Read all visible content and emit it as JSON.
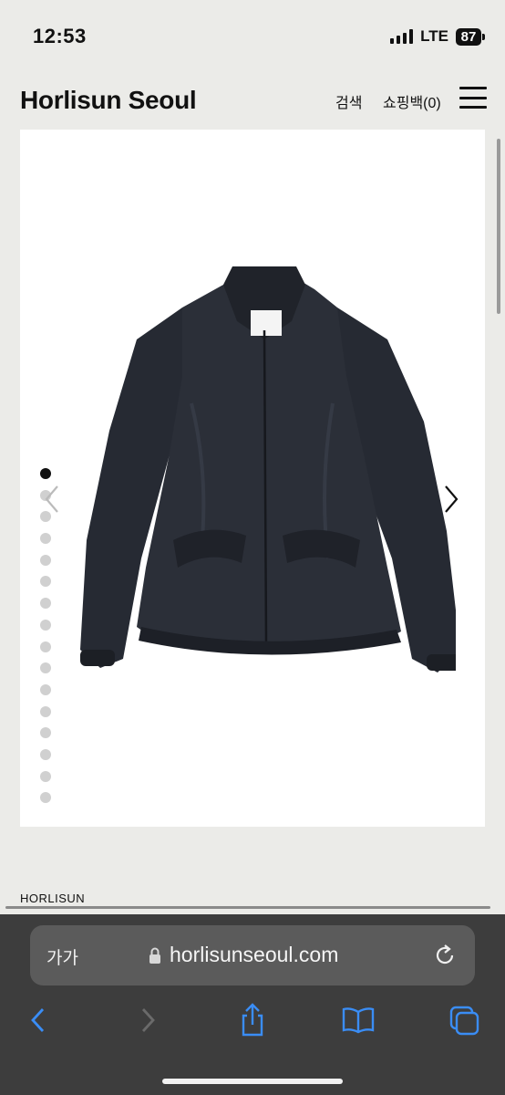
{
  "status_bar": {
    "time": "12:53",
    "network": "LTE",
    "battery": "87"
  },
  "header": {
    "logo": "Horlisun Seoul",
    "search_label": "검색",
    "cart_label": "쇼핑백(0)"
  },
  "gallery": {
    "total_images": 16,
    "active_index": 0
  },
  "brand": "HORLISUN",
  "browser": {
    "text_size_label": "가가",
    "url": "horlisunseoul.com"
  },
  "colors": {
    "background": "#ebebe8",
    "browser_bar": "#3d3d3d",
    "address_bar": "#5b5b5b",
    "accent_blue": "#3a8df5"
  }
}
